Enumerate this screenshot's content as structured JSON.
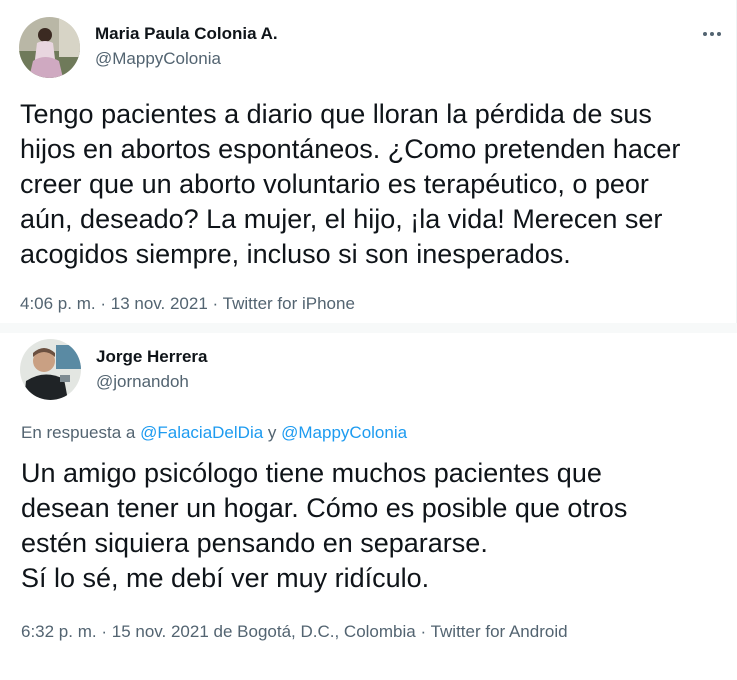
{
  "tweet1": {
    "name": "Maria Paula Colonia A.",
    "handle": "@MappyColonia",
    "more_icon": "more-horizontal-icon",
    "text": "Tengo pacientes a diario que lloran la pérdida de sus\nhijos en abortos espontáneos. ¿Como pretenden hacer\ncreer que un aborto voluntario es terapéutico, o peor\naún, deseado? La mujer, el hijo, ¡la vida! Merecen ser\nacogidos siempre, incluso si son inesperados.",
    "time": "4:06 p. m.",
    "date": "13 nov. 2021",
    "source": "Twitter for iPhone",
    "sep": "·"
  },
  "tweet2": {
    "name": "Jorge Herrera",
    "handle": "@jornandoh",
    "reply_prefix": "En respuesta a",
    "reply_mention1": "@FalaciaDelDia",
    "reply_and": "y",
    "reply_mention2": "@MappyColonia",
    "text": "Un amigo psicólogo tiene muchos pacientes que\ndesean tener un hogar. Cómo es posible que otros\nestén siquiera pensando en separarse.\nSí lo sé, me debí ver muy ridículo.",
    "time": "6:32 p. m.",
    "date_location": "15 nov. 2021 de Bogotá, D.C., Colombia",
    "source": "Twitter for Android",
    "sep": "·"
  },
  "colors": {
    "link": "#1d9bf0",
    "secondary": "#536471",
    "primary": "#0f1419",
    "divider": "#f7f9f9"
  }
}
